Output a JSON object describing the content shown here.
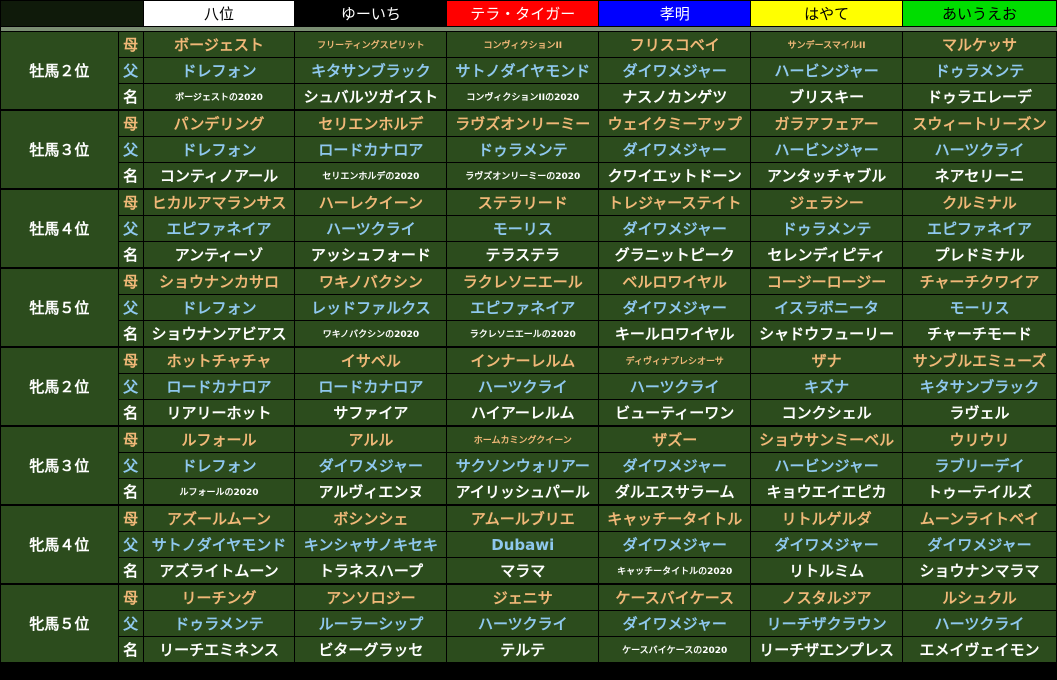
{
  "players": [
    {
      "name": "八位",
      "bg": "#ffffff",
      "fg": "#000000"
    },
    {
      "name": "ゆーいち",
      "bg": "#000000",
      "fg": "#ffffff"
    },
    {
      "name": "テラ・タイガー",
      "bg": "#ff0000",
      "fg": "#ffffff"
    },
    {
      "name": "孝明",
      "bg": "#0000ff",
      "fg": "#ffffff"
    },
    {
      "name": "はやて",
      "bg": "#ffff00",
      "fg": "#000000"
    },
    {
      "name": "あいうえお",
      "bg": "#00dd00",
      "fg": "#000000"
    }
  ],
  "row_labels": {
    "mom": "母",
    "dad": "父",
    "name": "名"
  },
  "groups": [
    {
      "label": "牡馬２位",
      "rows": {
        "mom": [
          "ボージェスト",
          "フリーティングスピリット",
          "コンヴィクションII",
          "フリスコベイ",
          "サンデースマイルII",
          "マルケッサ"
        ],
        "dad": [
          "ドレフォン",
          "キタサンブラック",
          "サトノダイヤモンド",
          "ダイワメジャー",
          "ハービンジャー",
          "ドゥラメンテ"
        ],
        "name": [
          "ボージェストの2020",
          "シュバルツガイスト",
          "コンヴィクションIIの2020",
          "ナスノカンゲツ",
          "ブリスキー",
          "ドゥラエレーデ"
        ]
      }
    },
    {
      "label": "牡馬３位",
      "rows": {
        "mom": [
          "パンデリング",
          "セリエンホルデ",
          "ラヴズオンリーミー",
          "ウェイクミーアップ",
          "ガラアフェアー",
          "スウィートリーズン"
        ],
        "dad": [
          "ドレフォン",
          "ロードカナロア",
          "ドゥラメンテ",
          "ダイワメジャー",
          "ハービンジャー",
          "ハーツクライ"
        ],
        "name": [
          "コンティノアール",
          "セリエンホルデの2020",
          "ラヴズオンリーミーの2020",
          "クワイエットドーン",
          "アンタッチャブル",
          "ネアセリーニ"
        ]
      }
    },
    {
      "label": "牡馬４位",
      "rows": {
        "mom": [
          "ヒカルアマランサス",
          "ハーレクイーン",
          "ステラリード",
          "トレジャーステイト",
          "ジェラシー",
          "クルミナル"
        ],
        "dad": [
          "エピファネイア",
          "ハーツクライ",
          "モーリス",
          "ダイワメジャー",
          "ドゥラメンテ",
          "エピファネイア"
        ],
        "name": [
          "アンティーゾ",
          "アッシュフォード",
          "テラステラ",
          "グラニットピーク",
          "セレンディピティ",
          "プレドミナル"
        ]
      }
    },
    {
      "label": "牡馬５位",
      "rows": {
        "mom": [
          "ショウナンカサロ",
          "ワキノバクシン",
          "ラクレソニエール",
          "ベルロワイヤル",
          "コージーロージー",
          "チャーチクワイア"
        ],
        "dad": [
          "ドレフォン",
          "レッドファルクス",
          "エピファネイア",
          "ダイワメジャー",
          "イスラボニータ",
          "モーリス"
        ],
        "name": [
          "ショウナンアビアス",
          "ワキノバクシンの2020",
          "ラクレソニエールの2020",
          "キールロワイヤル",
          "シャドウフューリー",
          "チャーチモード"
        ]
      }
    },
    {
      "label": "牝馬２位",
      "rows": {
        "mom": [
          "ホットチャチャ",
          "イサベル",
          "インナーレルム",
          "ディヴィナプレシオーサ",
          "ザナ",
          "サンブルエミューズ"
        ],
        "dad": [
          "ロードカナロア",
          "ロードカナロア",
          "ハーツクライ",
          "ハーツクライ",
          "キズナ",
          "キタサンブラック"
        ],
        "name": [
          "リアリーホット",
          "サファイア",
          "ハイアーレルム",
          "ビューティーワン",
          "コンクシェル",
          "ラヴェル"
        ]
      }
    },
    {
      "label": "牝馬３位",
      "rows": {
        "mom": [
          "ルフォール",
          "アルル",
          "ホームカミングクイーン",
          "ザズー",
          "ショウサンミーベル",
          "ウリウリ"
        ],
        "dad": [
          "ドレフォン",
          "ダイワメジャー",
          "サクソンウォリアー",
          "ダイワメジャー",
          "ハービンジャー",
          "ラブリーデイ"
        ],
        "name": [
          "ルフォールの2020",
          "アルヴィエンヌ",
          "アイリッシュパール",
          "ダルエスサラーム",
          "キョウエイエピカ",
          "トゥーテイルズ"
        ]
      }
    },
    {
      "label": "牝馬４位",
      "rows": {
        "mom": [
          "アズールムーン",
          "ボシンシェ",
          "アムールブリエ",
          "キャッチータイトル",
          "リトルゲルダ",
          "ムーンライトベイ"
        ],
        "dad": [
          "サトノダイヤモンド",
          "キンシャサノキセキ",
          "Dubawi",
          "ダイワメジャー",
          "ダイワメジャー",
          "ダイワメジャー"
        ],
        "name": [
          "アズライトムーン",
          "トラネスハープ",
          "マラマ",
          "キャッチータイトルの2020",
          "リトルミム",
          "ショウナンマラマ"
        ]
      }
    },
    {
      "label": "牝馬５位",
      "rows": {
        "mom": [
          "リーチング",
          "アンソロジー",
          "ジェニサ",
          "ケースバイケース",
          "ノスタルジア",
          "ルシュクル"
        ],
        "dad": [
          "ドゥラメンテ",
          "ルーラーシップ",
          "ハーツクライ",
          "ダイワメジャー",
          "リーチザクラウン",
          "ハーツクライ"
        ],
        "name": [
          "リーチエミネンス",
          "ビターグラッセ",
          "テルテ",
          "ケースバイケースの2020",
          "リーチザエンプレス",
          "エメイヴェイモン"
        ]
      }
    }
  ]
}
